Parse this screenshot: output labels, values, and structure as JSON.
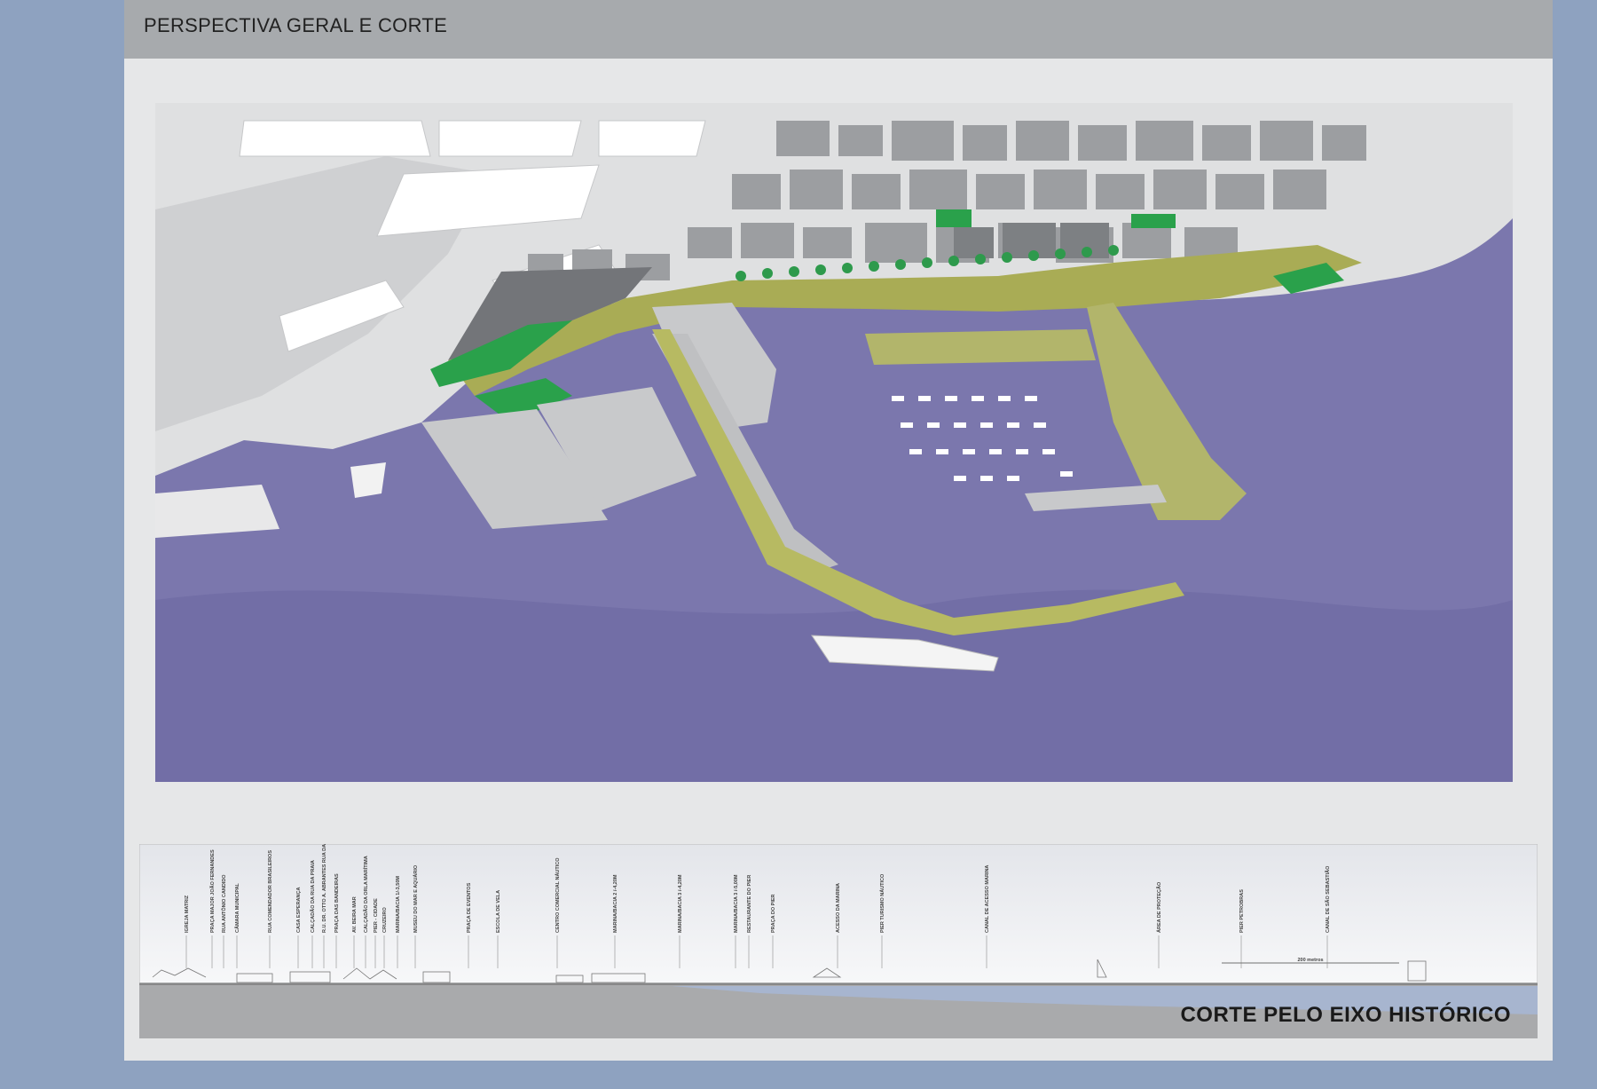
{
  "header": {
    "title": "PERSPECTIVA GERAL E CORTE"
  },
  "section": {
    "title": "CORTE PELO EIXO HISTÓRICO",
    "labels": [
      "IGREJA MATRIZ",
      "PRAÇA MAJOR JOÃO FERNANDES",
      "RUA ANTÔNIO CANDIDO",
      "CÂMARA MUNICIPAL",
      "RUA COMENDADOR BRASILEIROS",
      "CASA ESPERANÇA",
      "CALÇADÃO DA RUA DA PRAIA",
      "R.U. DR. OTTO A. ABRANTES RUA DA PRAIA",
      "PRAÇA DAS BANDEIRAS",
      "AV. BEIRA MAR",
      "CALÇADÃO DA ORLA MARÍTIMA",
      "PIER - CIDADE",
      "CRUZEIRO",
      "MARINA/BACIA 1/-3,50M",
      "MUSEU DO MAR E AQUÁRIO",
      "PRAÇA DE EVENTOS",
      "ESCOLA DE VELA",
      "CENTRO COMERCIAL NÁUTICO",
      "MARINA/BACIA 2 /-4,20M",
      "MARINA/BACIA 3 /-4,20M",
      "MARINA/BACIA 3 /-5,00M",
      "RESTAURANTE DO PIER",
      "PRAÇA DO PIER",
      "ACESSO DA MARINA",
      "PIER TURISMO NÁUTICO",
      "CANAL DE ACESSO MARINA",
      "ÁREA DE PROTEÇÃO",
      "PIER PETROBRAS",
      "CANAL DE SÃO SEBASTIÃO"
    ],
    "dimension_label": "200 metros"
  }
}
